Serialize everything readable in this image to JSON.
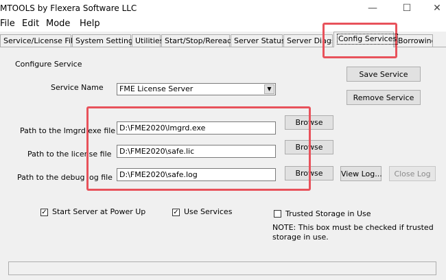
{
  "window": {
    "title": "MTOOLS by Flexera Software LLC",
    "controls": {
      "minimize": "—",
      "maximize": "☐",
      "close": "✕"
    }
  },
  "menu": [
    "File",
    "Edit",
    "Mode",
    "Help"
  ],
  "tabs": [
    "Service/License File",
    "System Settings",
    "Utilities",
    "Start/Stop/Reread",
    "Server Status",
    "Server Diags",
    "Config Services",
    "Borrowing"
  ],
  "active_tab": "Config Services",
  "config": {
    "section_label": "Configure Service",
    "service_name_label": "Service Name",
    "service_name_value": "FME License Server",
    "save_button": "Save Service",
    "remove_button": "Remove Service",
    "lmgrd_label": "Path to the lmgrd.exe file",
    "lmgrd_value": "D:\\FME2020\\lmgrd.exe",
    "license_label": "Path to the license file",
    "license_value": "D:\\FME2020\\safe.lic",
    "debug_label": "Path to the debug log file",
    "debug_value": "D:\\FME2020\\safe.log",
    "browse_label": "Browse",
    "view_log_button": "View Log...",
    "close_log_button": "Close Log",
    "start_power_up_label": "Start Server at Power Up",
    "start_power_up_checked": true,
    "use_services_label": "Use Services",
    "use_services_checked": true,
    "trusted_storage_label": "Trusted Storage in Use",
    "trusted_storage_checked": false,
    "note_text": "NOTE: This box must be checked if trusted storage in use."
  },
  "colors": {
    "highlight": "#e8525b",
    "background": "#f0f0f0"
  }
}
